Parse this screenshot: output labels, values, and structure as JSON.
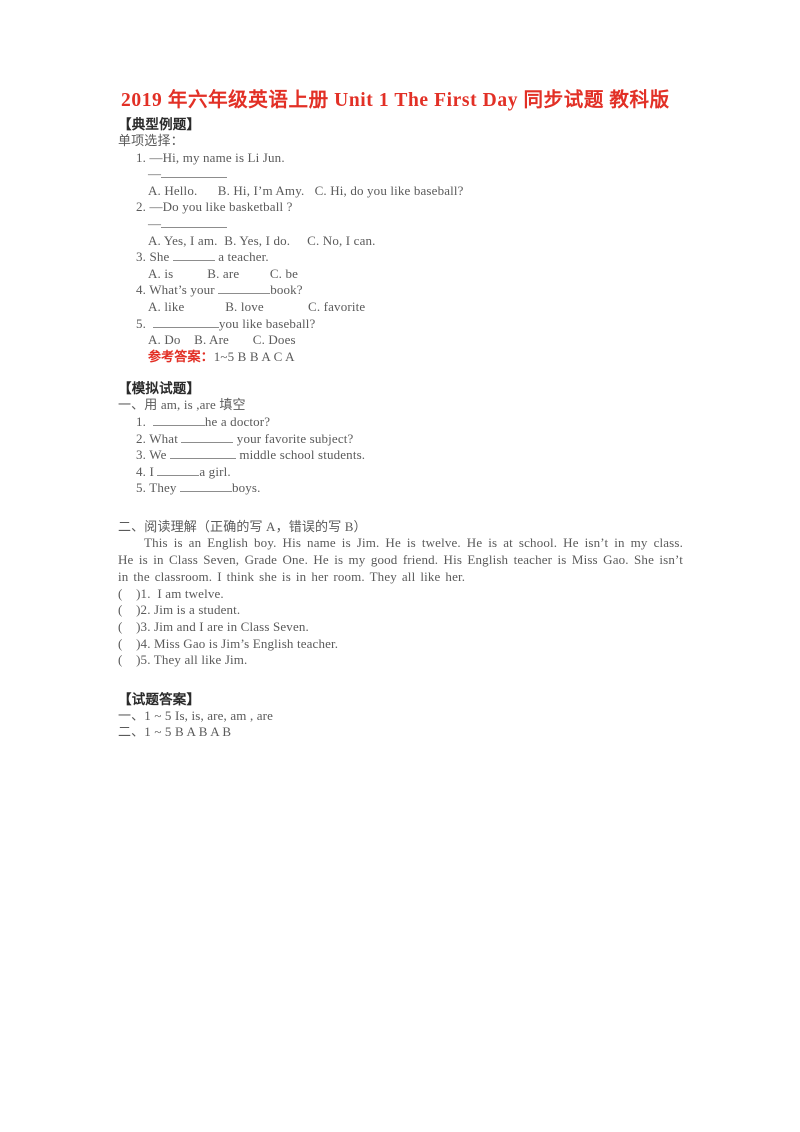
{
  "document": {
    "title": "2019 年六年级英语上册 Unit 1 The First Day 同步试题 教科版",
    "title_color": "#e23026",
    "body_color": "#5a5a5a"
  },
  "section_typical": {
    "heading": "【典型例题】",
    "subheading": "单项选择：",
    "questions": [
      {
        "number": "1.",
        "stem": "—Hi, my name is Li Jun.",
        "reply_prefix": "—",
        "options_line": "A. Hello.      B. Hi, I’m Amy.   C. Hi, do you like baseball?"
      },
      {
        "number": "2.",
        "stem": "—Do you like basketball ?",
        "reply_prefix": "—",
        "options_line": "A. Yes, I am.  B. Yes, I do.     C. No, I can."
      },
      {
        "number": "3.",
        "stem_before": "She ",
        "stem_after": " a teacher.",
        "options_line": "A. is          B. are         C. be"
      },
      {
        "number": "4.",
        "stem_before": "What’s your ",
        "stem_after": "book?",
        "options_line": "A. like            B. love             C. favorite"
      },
      {
        "number": "5.",
        "stem_before": " ",
        "stem_after": "you like baseball?",
        "options_line": "A. Do    B. Are       C. Does"
      }
    ],
    "answer_label": "参考答案：",
    "answer_value": "1~5 B B A C A"
  },
  "section_mock": {
    "heading": "【模拟试题】",
    "part_one_title": "一、用 am, is ,are 填空",
    "part_one_items": [
      {
        "number": "1.",
        "before": " ",
        "after": "he a doctor?"
      },
      {
        "number": "2.",
        "before": "What ",
        "after": " your favorite subject?"
      },
      {
        "number": "3.",
        "before": "We ",
        "after": " middle school students."
      },
      {
        "number": "4.",
        "before": "I ",
        "after": "a girl."
      },
      {
        "number": "5.",
        "before": "They ",
        "after": "boys."
      }
    ],
    "part_two_title": "二、阅读理解（正确的写 A，错误的写 B）",
    "passage": "This is an English boy. His name is Jim. He is twelve. He is at school. He isn’t in my class. He is in Class Seven, Grade One. He is my good friend. His English teacher is Miss Gao. She isn’t in the classroom. I think she is in her room. They all like her.",
    "tf_items": [
      "(    )1.  I am twelve.",
      "(    )2. Jim is a student.",
      "(    )3. Jim and I are in Class Seven.",
      "(    )4. Miss Gao is Jim’s English teacher.",
      "(    )5. They all like Jim."
    ]
  },
  "section_answers": {
    "heading": "【试题答案】",
    "lines": [
      "一、1 ~ 5 Is, is, are, am , are",
      "二、1 ~ 5 B A B A B"
    ]
  }
}
